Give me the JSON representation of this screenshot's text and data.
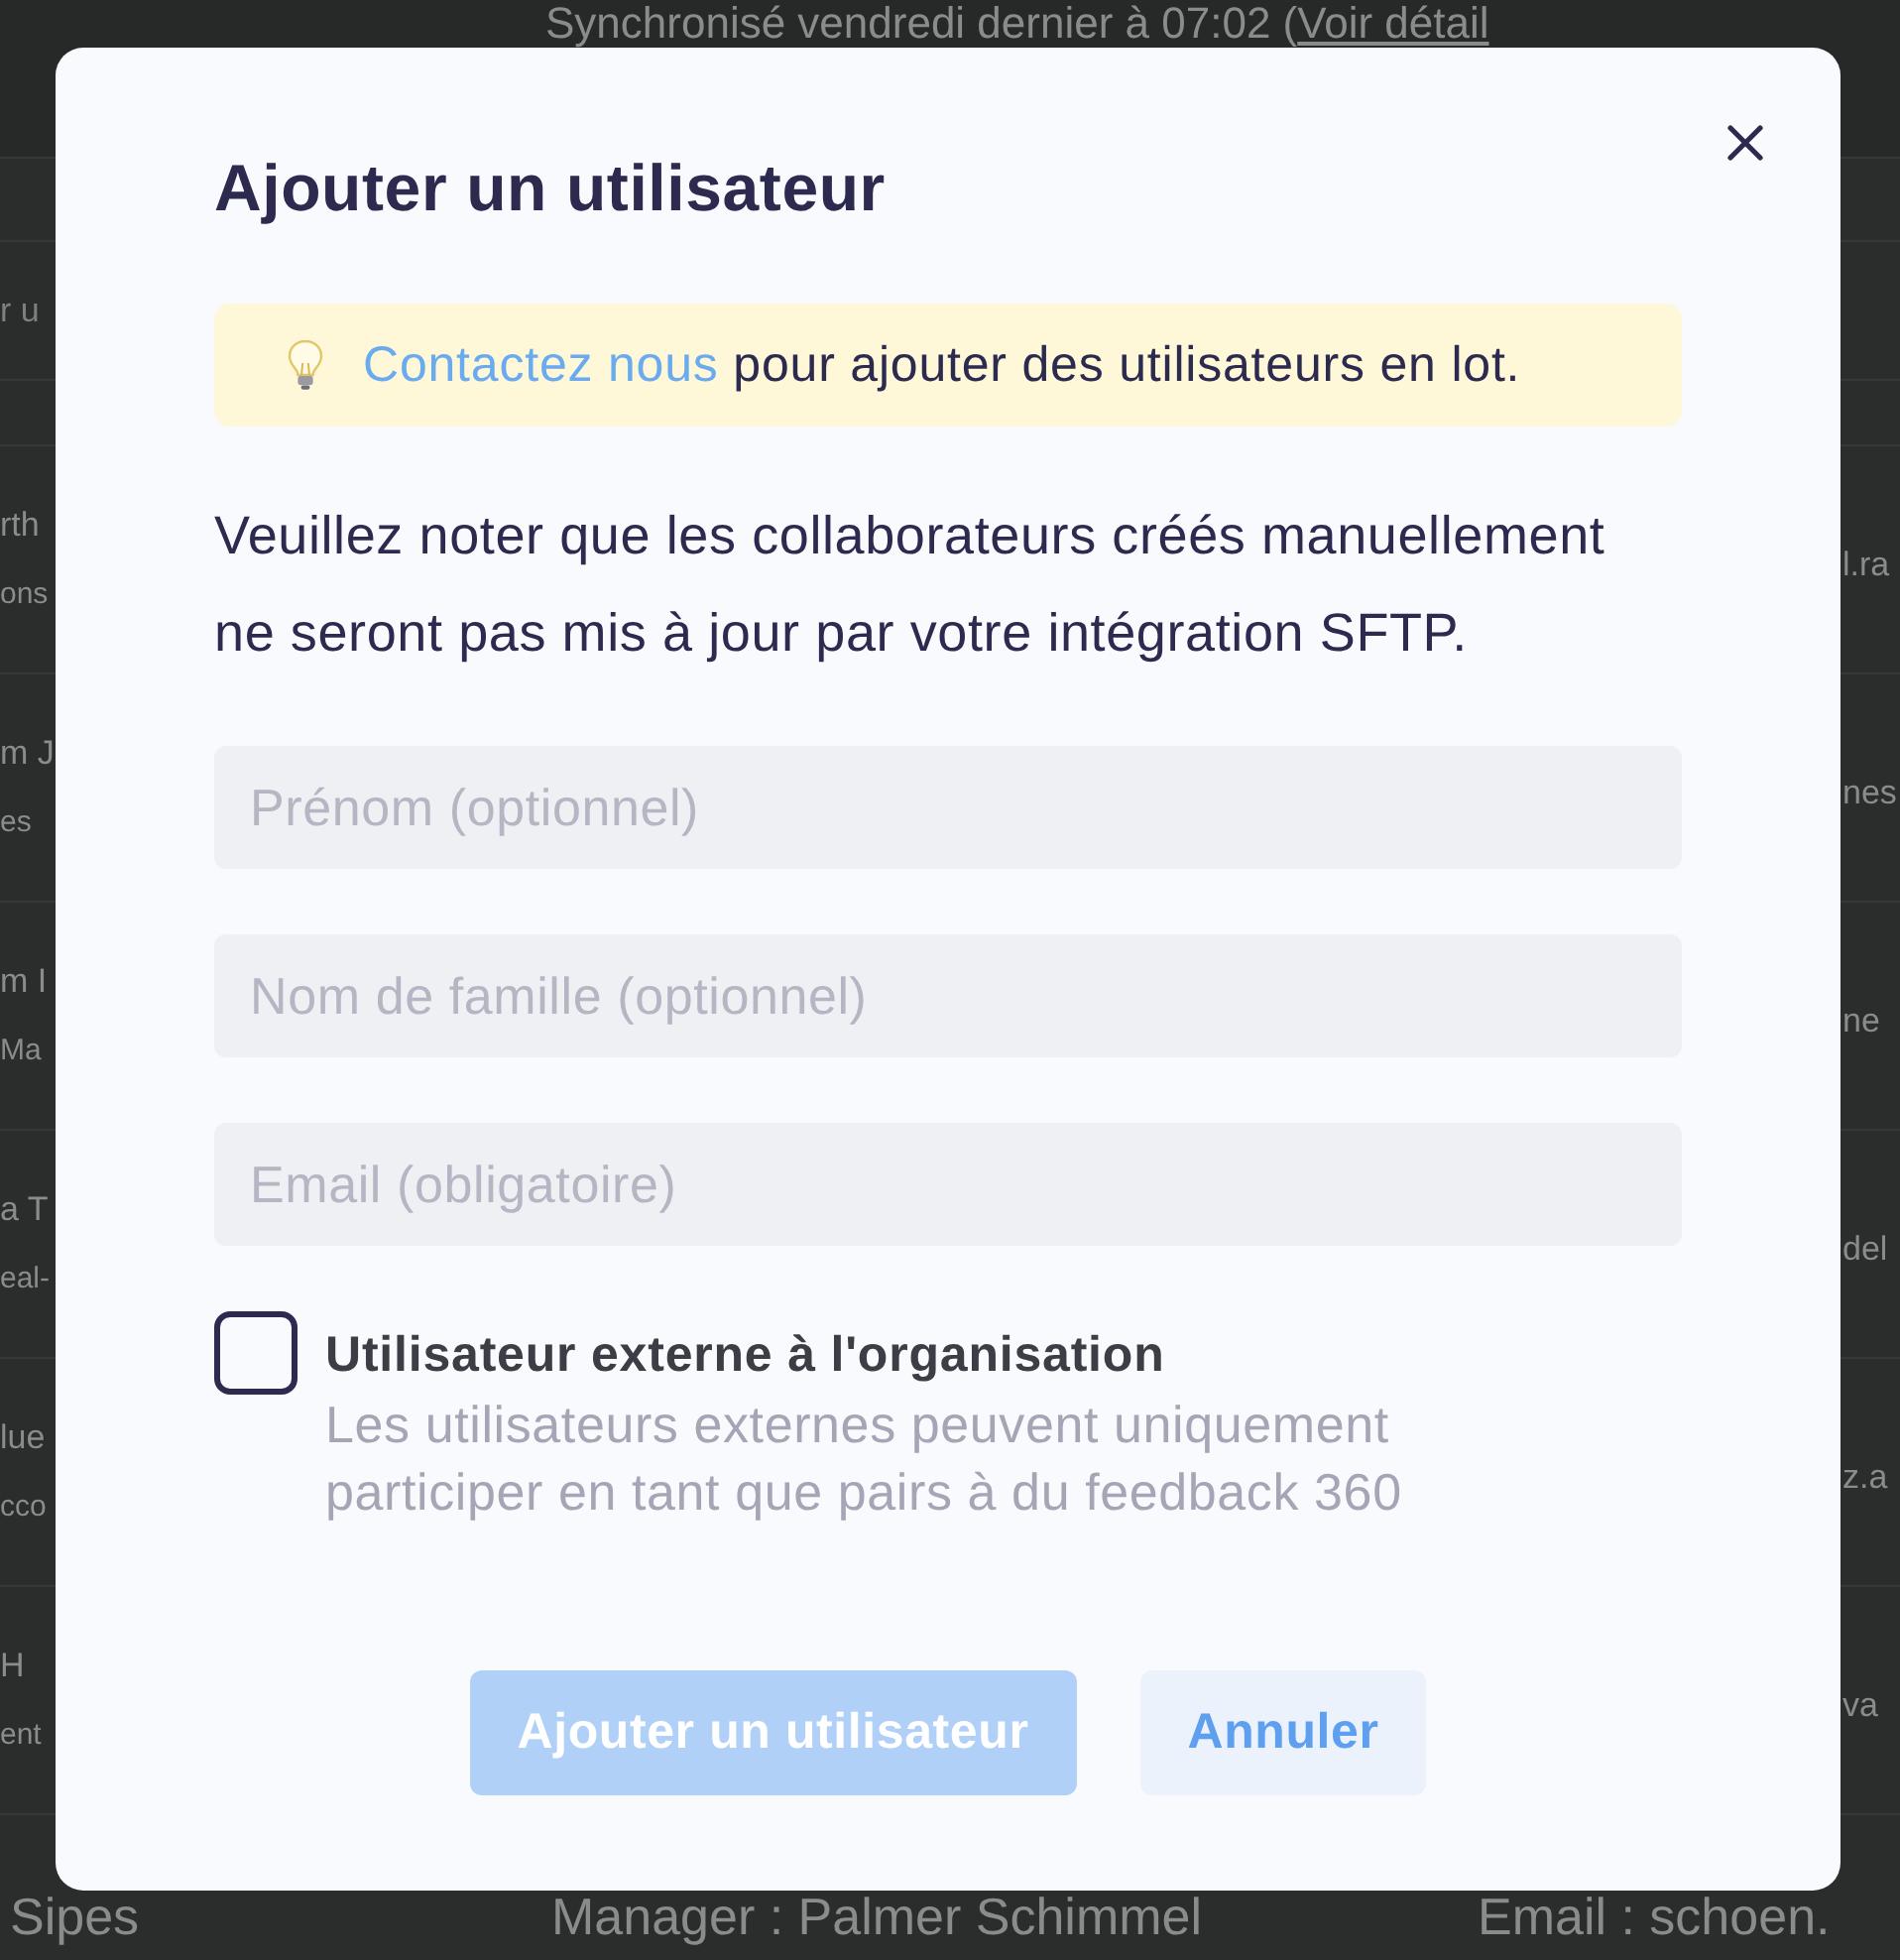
{
  "page": {
    "sync": {
      "text": "Synchronisé vendredi dernier à 07:02 (",
      "link": "Voir détail"
    },
    "search": {
      "placeholder": "r u"
    },
    "rows": [
      {
        "kind": "edge",
        "name": "rth",
        "detail": "ons",
        "email": "l.ra"
      },
      {
        "kind": "edge",
        "name": "m J",
        "detail": "es",
        "email": "nes"
      },
      {
        "kind": "edge",
        "name": "m I",
        "detail": "Ma",
        "email": "ne"
      },
      {
        "kind": "edge",
        "name": "a T",
        "detail": "eal-",
        "email": "del"
      },
      {
        "kind": "edge",
        "name": "lue",
        "detail": "cco",
        "email": "z.a"
      },
      {
        "kind": "edge",
        "name": "H",
        "detail": "ent",
        "email": "va"
      },
      {
        "kind": "open",
        "name": "Sipes",
        "manager": "Manager : Palmer Schimmel",
        "email": "Email : schoen."
      }
    ]
  },
  "dialog": {
    "title": "Ajouter un utilisateur",
    "banner": {
      "link": "Contactez nous",
      "text": "pour ajouter des utilisateurs en lot."
    },
    "notice": "Veuillez noter que les collaborateurs créés manuellement ne seront pas mis à jour par votre intégration SFTP.",
    "fields": [
      {
        "placeholder": "Prénom (optionnel)"
      },
      {
        "placeholder": "Nom de famille (optionnel)"
      },
      {
        "placeholder": "Email (obligatoire)"
      }
    ],
    "external": {
      "checked": false,
      "label": "Utilisateur externe à l'organisation",
      "description": "Les utilisateurs externes peuvent uniquement participer en tant que pairs à du feedback 360"
    },
    "buttons": [
      {
        "kind": "primary",
        "label": "Ajouter un utilisateur",
        "disabled": true
      },
      {
        "kind": "secondary",
        "label": "Annuler"
      }
    ]
  }
}
